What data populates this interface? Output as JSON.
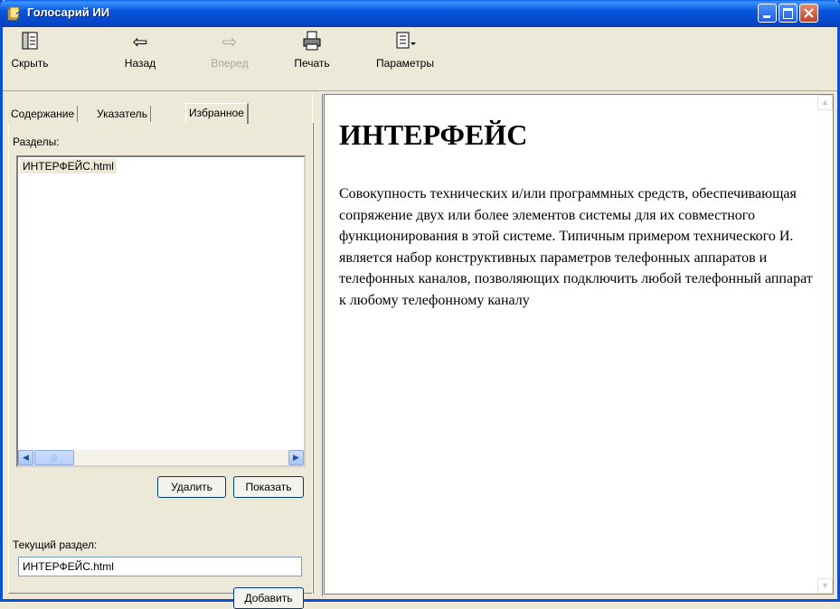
{
  "window": {
    "title": "Голосарий ИИ"
  },
  "toolbar": {
    "hide": "Скрыть",
    "back": "Назад",
    "forward": "Вперед",
    "print": "Печать",
    "options": "Параметры"
  },
  "tabs": [
    {
      "label": "Содержание",
      "active": false
    },
    {
      "label": "Указатель",
      "active": false
    },
    {
      "label": "Избранное",
      "active": true
    }
  ],
  "favorites": {
    "sections_label": "Разделы:",
    "items": [
      "ИНТЕРФЕЙС.html"
    ],
    "delete_button": "Удалить",
    "show_button": "Показать",
    "current_label": "Текущий раздел:",
    "current_value": "ИНТЕРФЕЙС.html",
    "add_button": "Добавить"
  },
  "document": {
    "heading": "ИНТЕРФЕЙС",
    "body": "Совокупность технических и/или программных средств, обеспечивающая сопряжение двух или более элементов системы для их совместного функционирования в этой системе. Типичным примером технического И. является набор конструктивных параметров телефонных аппаратов и телефонных каналов, позволяющих подключить любой телефонный аппарат к любому телефонному каналу"
  },
  "colors": {
    "titlebar": "#0855dd",
    "window_bg": "#ece9d8",
    "close_button": "#c4402c"
  }
}
